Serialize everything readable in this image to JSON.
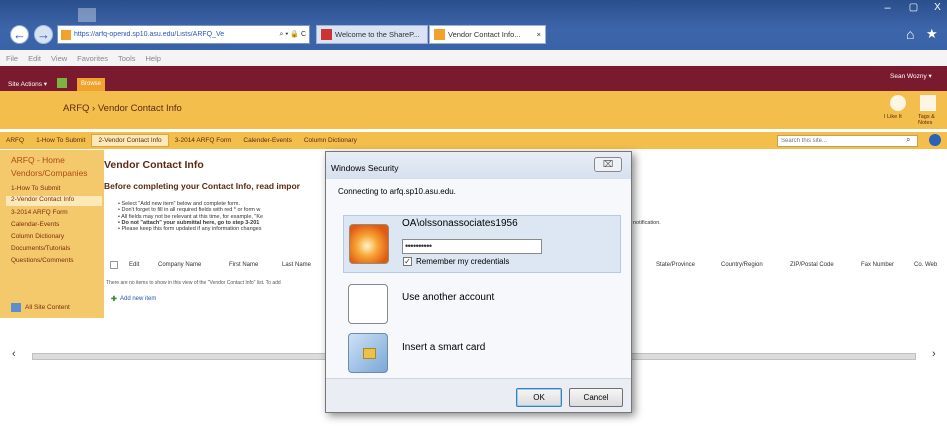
{
  "browser": {
    "address_url": "https://arfq-openid.sp10.asu.edu/Lists/ARFQ_Ve",
    "address_icons": "⌕ ▾ 🔒 C",
    "tabs": [
      {
        "label": "Welcome to the ShareP..."
      },
      {
        "label": "Vendor Contact Info...",
        "close": "×"
      }
    ],
    "menu": [
      "File",
      "Edit",
      "View",
      "Favorites",
      "Tools",
      "Help"
    ],
    "window_controls": {
      "minimize": "–",
      "maximize": "▢",
      "close": "X"
    }
  },
  "ribbon": {
    "site_actions": "Site Actions ▾",
    "browse": "Browse",
    "user": "Sean Wozny ▾"
  },
  "header": {
    "breadcrumb_site": "ARFQ",
    "breadcrumb_sep": "›",
    "breadcrumb_page": "Vendor Contact Info",
    "i_like_it": "I Like It",
    "tags_notes": "Tags & Notes"
  },
  "topnav": {
    "items": [
      "ARFQ",
      "1-How To Submit",
      "2-Vendor Contact Info",
      "3-2014 ARFQ Form",
      "Calender-Events",
      "Column Dictionary"
    ],
    "search_placeholder": "Search this site..."
  },
  "quicklaunch": {
    "heading1": "ARFQ - Home",
    "heading2": "Vendors/Companies",
    "items": [
      "1-How To Submit",
      "2-Vendor Contact Info",
      "3-2014 ARFQ Form",
      "Calendar-Events",
      "Column Dictionary",
      "Documents/Tutorials",
      "Questions/Comments"
    ],
    "all_site_content": "All Site Content"
  },
  "main": {
    "title": "Vendor Contact Info",
    "subtitle": "Before completing your Contact Info, read impor",
    "bullets": [
      "Select \"Add new item\" below and complete form.",
      "Don't forget to fill in all required fields with red * or form w",
      "All fields may not be relevant at this time, for example, \"Ke",
      "Do not \"attach\" your submittal here, go to step 3-201",
      "Please keep this form updated if any information changes"
    ],
    "notification_tail": "notification.",
    "columns_left": [
      "Edit",
      "Company Name",
      "First Name",
      "Last Name"
    ],
    "columns_right": [
      "State/Province",
      "Country/Region",
      "ZIP/Postal Code",
      "Fax Number",
      "Co. Web"
    ],
    "empty_message": "There are no items to show in this view of the \"Vendor Contact Info\" list. To add",
    "add_new_item": "Add new item"
  },
  "dialog": {
    "title": "Windows Security",
    "connecting": "Connecting to arfq.sp10.asu.edu.",
    "username": "OA\\olssonassociates1956",
    "password_mask": "••••••••••",
    "remember_label": "Remember my credentials",
    "remember_checked": true,
    "other_account": "Use another account",
    "smart_card": "Insert a smart card",
    "ok": "OK",
    "cancel": "Cancel",
    "close_glyph": "⌧"
  },
  "colors": {
    "ribbon": "#7a1a2e",
    "header": "#f3be4c",
    "quicklaunch": "#f4c96c",
    "titlebar": "#3a62a6"
  }
}
